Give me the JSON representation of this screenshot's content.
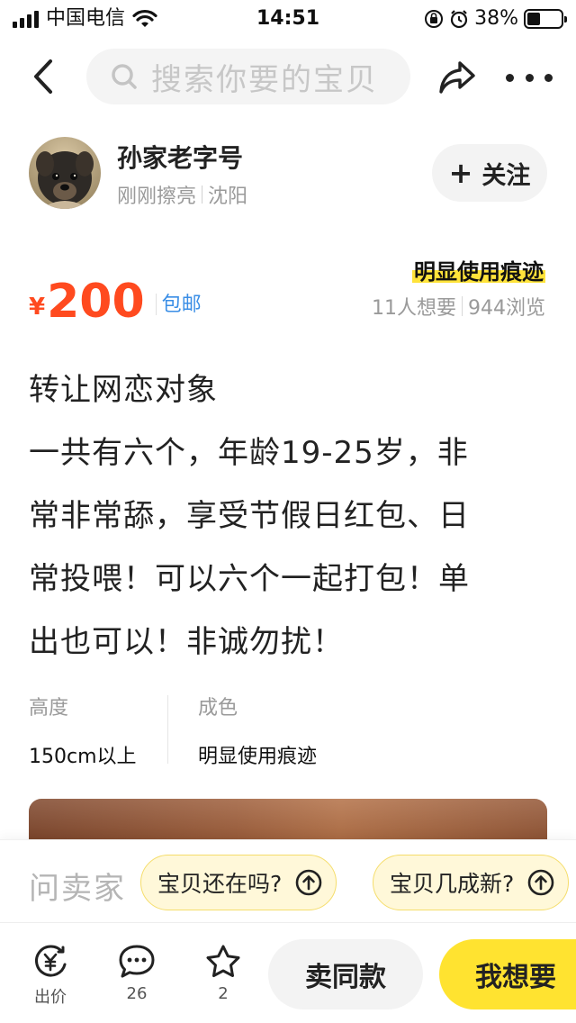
{
  "status_bar": {
    "carrier": "中国电信",
    "time": "14:51",
    "battery": "38%",
    "battery_level": 0.38,
    "icons": [
      "signal-icon",
      "wifi-icon",
      "orientation-lock-icon",
      "alarm-icon",
      "battery-icon"
    ]
  },
  "nav": {
    "back_icon": "chevron-left-icon",
    "search_placeholder": "搜索你要的宝贝",
    "share_icon": "share-icon",
    "more_icon": "more-dots-icon"
  },
  "seller": {
    "name": "孙家老字号",
    "activity": "刚刚擦亮",
    "location": "沈阳",
    "follow_label": "关注"
  },
  "item": {
    "condition_tag": "明显使用痕迹",
    "currency": "¥",
    "price": "200",
    "shipping": "包邮",
    "wants": "11人想要",
    "views": "944浏览",
    "description": [
      "转让网恋对象",
      "一共有六个，年龄19-25岁，非",
      "常非常舔，享受节假日红包、日",
      "常投喂！可以六个一起打包！单",
      "出也可以！非诚勿扰！"
    ],
    "attributes": [
      {
        "key": "高度",
        "value": "150cm以上"
      },
      {
        "key": "成色",
        "value": "明显使用痕迹"
      }
    ]
  },
  "ask": {
    "label": "问卖家",
    "chips": [
      "宝贝还在吗?",
      "宝贝几成新?"
    ]
  },
  "actions": {
    "bid_label": "出价",
    "comments_count": "26",
    "favorites_count": "2",
    "same_label": "卖同款",
    "want_label": "我想要"
  },
  "colors": {
    "price": "#ff4a1f",
    "shipping": "#3a8ee6",
    "highlight": "#ffe33a",
    "want_button": "#ffe330"
  }
}
